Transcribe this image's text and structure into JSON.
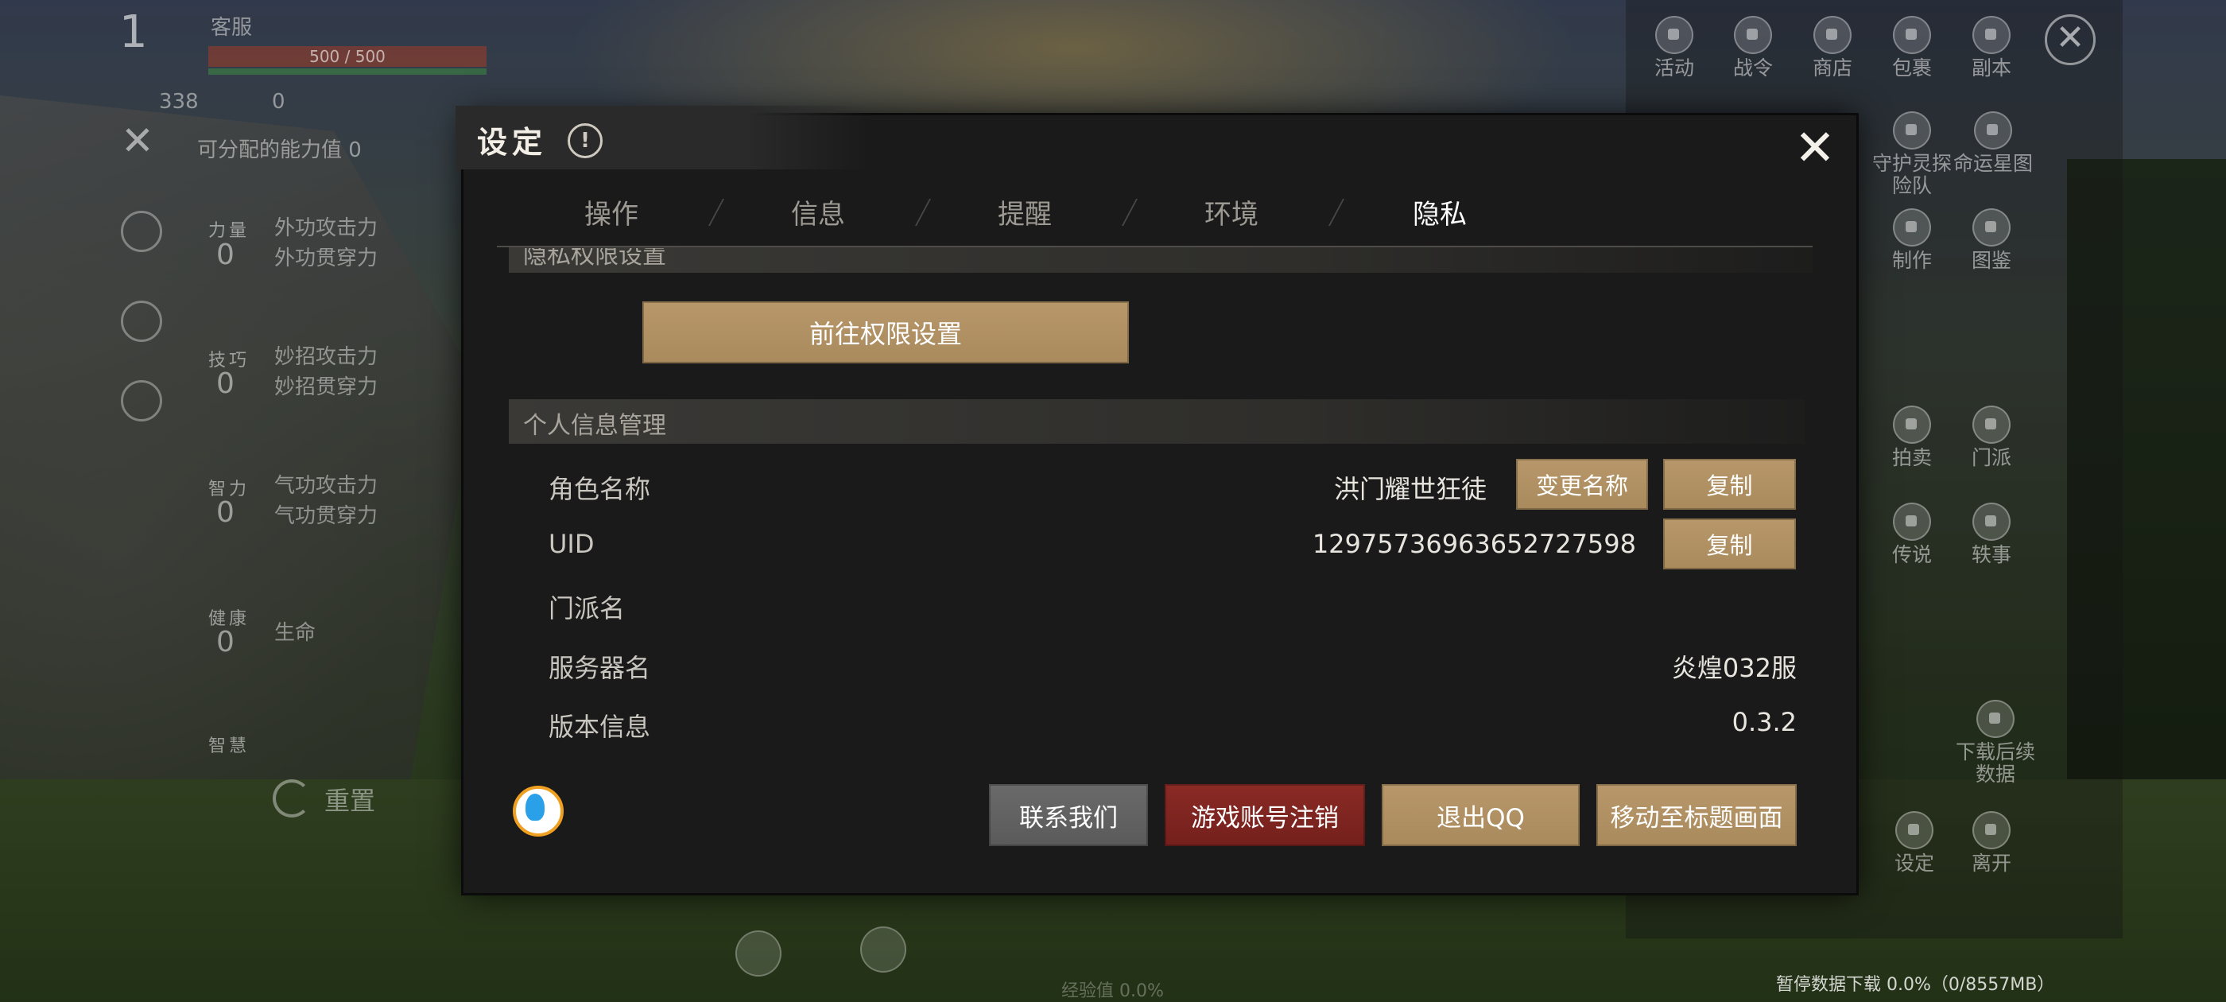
{
  "hud_left": {
    "level": "1",
    "server": "客服",
    "hp_text": "500 / 500",
    "stat_a": "338",
    "stat_b": "0",
    "available_points_label": "可分配的能力值",
    "available_points_value": "0",
    "attributes": [
      {
        "label": "力量",
        "value": "0",
        "desc1": "外功攻击力",
        "desc2": "外功贯穿力"
      },
      {
        "label": "技巧",
        "value": "0",
        "desc1": "妙招攻击力",
        "desc2": "妙招贯穿力"
      },
      {
        "label": "智力",
        "value": "0",
        "desc1": "气功攻击力",
        "desc2": "气功贯穿力"
      },
      {
        "label": "健康",
        "value": "0",
        "desc1": "生命",
        "desc2": ""
      },
      {
        "label": "智慧",
        "value": "",
        "desc1": "",
        "desc2": ""
      }
    ],
    "reset_label": "重置"
  },
  "hud_right": {
    "menu": [
      {
        "label": "活动",
        "icon": "lock-icon"
      },
      {
        "label": "战令",
        "icon": "lock-icon"
      },
      {
        "label": "商店",
        "icon": "lock-icon"
      },
      {
        "label": "包裹",
        "icon": "lock-icon"
      },
      {
        "label": "副本",
        "icon": "lock-icon"
      },
      {
        "label": "守护灵探险队",
        "icon": "lock-icon"
      },
      {
        "label": "命运星图",
        "icon": "lock-icon"
      },
      {
        "label": "制作",
        "icon": "lock-icon"
      },
      {
        "label": "图鉴",
        "icon": "lock-icon"
      },
      {
        "label": "拍卖",
        "icon": "lock-icon"
      },
      {
        "label": "门派",
        "icon": "lock-icon"
      },
      {
        "label": "传说",
        "icon": "lock-icon"
      },
      {
        "label": "轶事",
        "icon": "lock-icon"
      },
      {
        "label": "下载后续数据",
        "icon": "download-icon"
      },
      {
        "label": "设定",
        "icon": "gear-icon"
      },
      {
        "label": "离开",
        "icon": "exit-icon"
      }
    ],
    "download_status": "暂停数据下载 0.0%（0/8557MB）",
    "exp_text": "经验值 0.0%"
  },
  "dialog": {
    "title": "设定",
    "tabs": [
      "操作",
      "信息",
      "提醒",
      "环境",
      "隐私"
    ],
    "active_tab": "隐私",
    "privacy_section_title": "隐私权限设置",
    "goto_permission_button": "前往权限设置",
    "personal_section_title": "个人信息管理",
    "rows": {
      "role_name_label": "角色名称",
      "role_name_value": "洪门耀世狂徒",
      "rename_button": "变更名称",
      "copy_button": "复制",
      "uid_label": "UID",
      "uid_value": "12975736963652727598",
      "sect_label": "门派名",
      "sect_value": "",
      "server_label": "服务器名",
      "server_value": "炎煌032服",
      "version_label": "版本信息",
      "version_value": "0.3.2"
    },
    "footer_buttons": {
      "contact": "联系我们",
      "cancel_account": "游戏账号注销",
      "logout_qq": "退出QQ",
      "title_screen": "移动至标题画面"
    }
  },
  "colors": {
    "gold_button": "#b8986a",
    "red_button": "#8a2a25",
    "gray_button": "#6a6a6a",
    "dialog_bg": "#1a1a1a"
  }
}
